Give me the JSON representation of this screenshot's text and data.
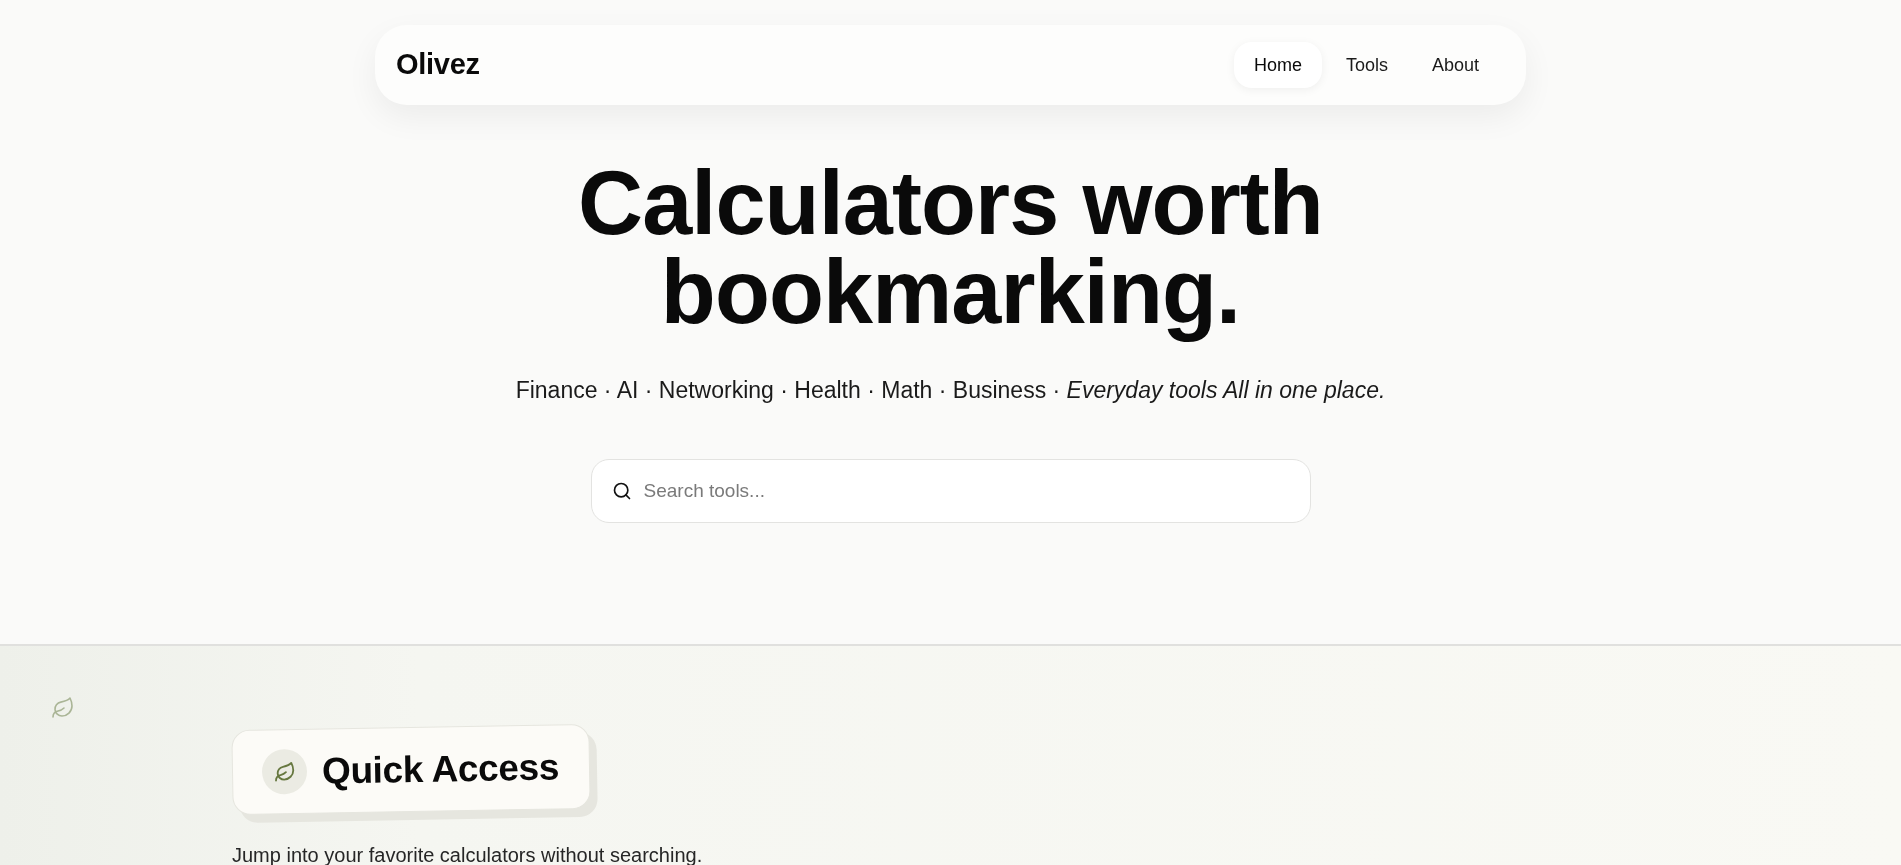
{
  "nav": {
    "logo": "Olivez",
    "links": [
      {
        "label": "Home",
        "selected": true
      },
      {
        "label": "Tools",
        "selected": false
      },
      {
        "label": "About",
        "selected": false
      }
    ]
  },
  "hero": {
    "title": "Calculators worth bookmarking.",
    "subtitle": "Finance · AI · Networking · Health · Math · Business · *Everyday tools All in one place.*",
    "search": {
      "placeholder": "Search tools..."
    }
  },
  "quick_access": {
    "title": "Quick Access",
    "description": "Jump into your favorite calculators without searching."
  }
}
